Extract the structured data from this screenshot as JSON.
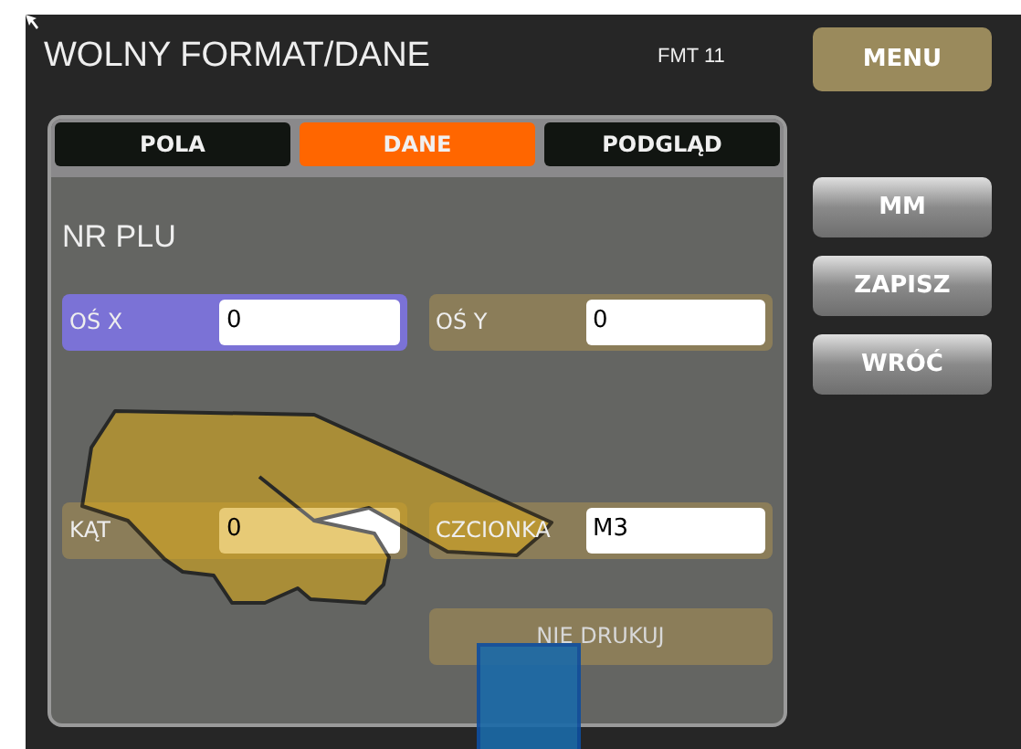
{
  "header": {
    "title": "WOLNY FORMAT/DANE",
    "code": "FMT 11",
    "menu_button": "MENU"
  },
  "tabs": [
    {
      "label": "POLA",
      "selected": false
    },
    {
      "label": "DANE",
      "selected": true
    },
    {
      "label": "PODGLĄD",
      "selected": false
    }
  ],
  "section_title": "NR PLU",
  "fields": [
    {
      "label": "OŚ X",
      "value": "0",
      "selected": true
    },
    {
      "label": "OŚ Y",
      "value": "0",
      "selected": false
    },
    {
      "label": "KĄT",
      "value": "0",
      "selected": false
    },
    {
      "label": "CZCIONKA",
      "value": "M3",
      "selected": false
    }
  ],
  "print_button": "NIE DRUKUJ",
  "side_buttons": [
    "MM",
    "ZAPISZ",
    "WRÓĆ"
  ]
}
